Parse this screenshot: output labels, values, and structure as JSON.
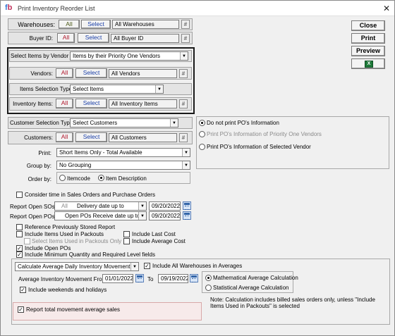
{
  "window": {
    "title": "Print Inventory Reorder List",
    "logo_a": "f",
    "logo_b": "b",
    "close_glyph": "✕"
  },
  "buttons": {
    "all": "All",
    "select": "Select",
    "hash": "#"
  },
  "warehouses": {
    "label": "Warehouses:",
    "value": "All Warehouses"
  },
  "buyer": {
    "label": "Buyer ID:",
    "value": "All Buyer ID"
  },
  "vendor_select": {
    "label": "Select Items by Vendor",
    "value": "Items by their Priority One Vendors"
  },
  "vendors": {
    "label": "Vendors:",
    "value": "All Vendors"
  },
  "item_sel_type": {
    "label": "Items Selection Type:",
    "value": "Select Items"
  },
  "inventory_items": {
    "label": "Inventory Items:",
    "value": "All Inventory Items"
  },
  "customer_sel_type": {
    "label": "Customer Selection Type:",
    "value": "Select Customers"
  },
  "customers": {
    "label": "Customers:",
    "value": "All Customers"
  },
  "po_info": {
    "opt1": "Do not print PO's Information",
    "opt2": "Print PO's Information of Priority One Vendors",
    "opt3": "Print PO's Information of Selected Vendor"
  },
  "print": {
    "label": "Print:",
    "value": "Short Items Only - Total Available"
  },
  "group_by": {
    "label": "Group by:",
    "value": "No Grouping"
  },
  "order_by": {
    "label": "Order by:",
    "opt1": "Itemcode",
    "opt2": "Item Description"
  },
  "consider_time": "Consider time in Sales Orders and Purchase Orders",
  "open_sos": {
    "label": "Report Open SOs:",
    "all": "All",
    "value": "Delivery date up to",
    "date": "09/20/2022"
  },
  "open_pos": {
    "label": "Report Open POs:",
    "value": "Open POs Receive date up to",
    "date": "09/20/2022"
  },
  "options": {
    "ref_prev": "Reference Previously Stored Report",
    "incl_packouts": "Include Items Used in Packouts",
    "sel_packouts": "Select Items Used in Packouts Only",
    "incl_last_cost": "Include Last Cost",
    "incl_avg_cost": "Include Average Cost",
    "incl_open_pos": "Include Open POs",
    "incl_min_qty": "Include Minimum Quantity and Required Level fields"
  },
  "movement": {
    "combo": "Calculate Average Daily Inventory Movement",
    "all_wh": "Include All Warehouses in Averages",
    "from_label": "Average Inventory Movement From",
    "from_date": "01/01/2022",
    "to_label": "To",
    "to_date": "09/19/2022",
    "weekends": "Include weekends and holidays",
    "math": "Mathematical Average Calculation",
    "stat": "Statistical Average Calculation",
    "note": "Note:  Calculation includes billed sales orders only, unless \"Include Items Used in Packouts\" is selected",
    "report_total": "Report total movement average sales"
  },
  "side": {
    "close": "Close",
    "print": "Print",
    "preview": "Preview",
    "excel_glyph": "X"
  }
}
